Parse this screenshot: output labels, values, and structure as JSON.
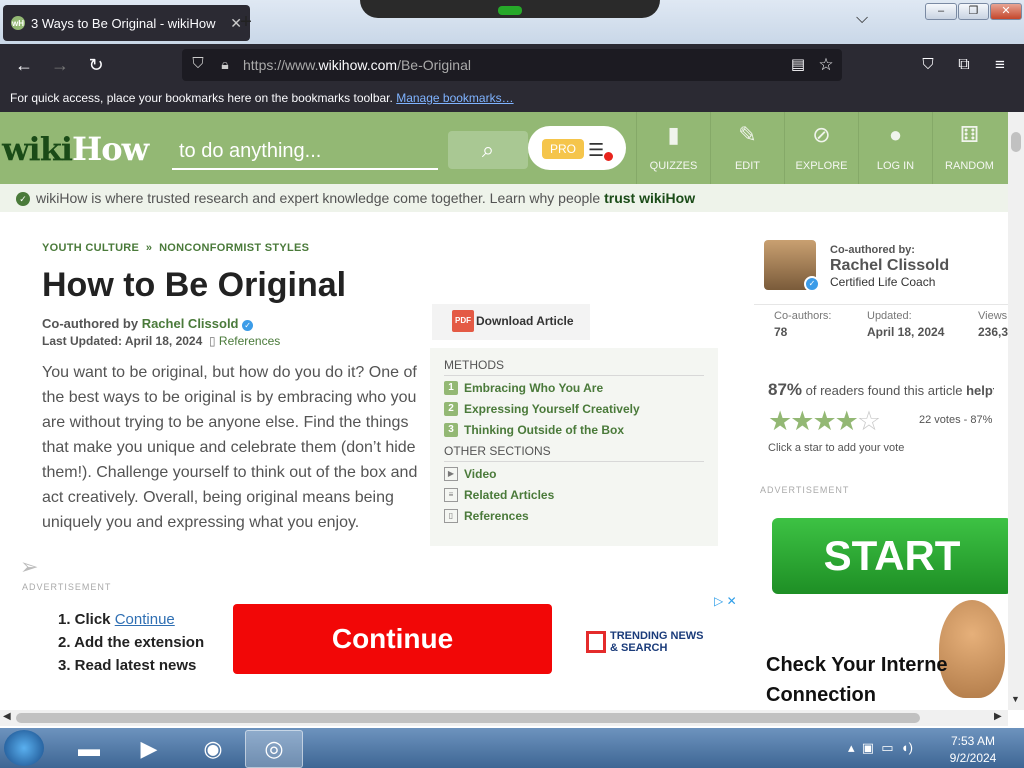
{
  "browser": {
    "tab_title": "3 Ways to Be Original - wikiHow",
    "tab_favicon": "wH",
    "url_prefix": "https://www.",
    "url_domain": "wikihow.com",
    "url_path": "/Be-Original",
    "bookmarks_text": "For quick access, place your bookmarks here on the bookmarks toolbar.",
    "bookmarks_link": "Manage bookmarks…"
  },
  "header": {
    "logo_wiki": "wiki",
    "logo_how": "How",
    "search_placeholder": "to do anything...",
    "pro_label": "PRO",
    "nav": [
      {
        "label": "QUIZZES",
        "icon": "quizzes-icon",
        "glyph": "▮"
      },
      {
        "label": "EDIT",
        "icon": "edit-icon",
        "glyph": "✎"
      },
      {
        "label": "EXPLORE",
        "icon": "explore-icon",
        "glyph": "⊘"
      },
      {
        "label": "LOG IN",
        "icon": "user-icon",
        "glyph": "●"
      },
      {
        "label": "RANDOM",
        "icon": "random-icon",
        "glyph": "⚅"
      }
    ]
  },
  "trust": {
    "text": "wikiHow is where trusted research and expert knowledge come together. Learn why people ",
    "bold": "trust wikiHow"
  },
  "article": {
    "breadcrumb_1": "YOUTH CULTURE",
    "breadcrumb_sep": "»",
    "breadcrumb_2": "NONCONFORMIST STYLES",
    "title": "How to Be Original",
    "coauthored_label": "Co-authored by",
    "coauthor": "Rachel Clissold",
    "updated": "Last Updated: April 18, 2024",
    "references": "References",
    "intro": "You want to be original, but how do you do it? One of the best ways to be original is by embracing who you are without trying to be anyone else. Find the things that make you unique and celebrate them (don’t hide them!). Challenge yourself to think out of the box and act creatively. Overall, being original means being uniquely you and expressing what you enjoy.",
    "download": "Download Article",
    "pdf": "PDF"
  },
  "toc": {
    "methods_heading": "METHODS",
    "methods": [
      {
        "num": "1",
        "label": "Embracing Who You Are"
      },
      {
        "num": "2",
        "label": "Expressing Yourself Creatively"
      },
      {
        "num": "3",
        "label": "Thinking Outside of the Box"
      }
    ],
    "other_heading": "OTHER SECTIONS",
    "other": [
      {
        "label": "Video"
      },
      {
        "label": "Related Articles"
      },
      {
        "label": "References"
      }
    ]
  },
  "ad": {
    "label": "ADVERTISEMENT",
    "step1_prefix": "1. Click ",
    "step1_link": "Continue",
    "step2": "2. Add the extension",
    "step3": "3. Read latest news",
    "button": "Continue",
    "brand_line1": "TRENDING NEWS",
    "brand_line2": "& SEARCH"
  },
  "sidebar": {
    "coauth_heading": "Co-authored by:",
    "name": "Rachel Clissold",
    "role": "Certified Life Coach",
    "coauthors_label": "Co-authors:",
    "coauthors_value": "78",
    "updated_label": "Updated:",
    "updated_value": "April 18, 2024",
    "views_label": "Views",
    "views_value": "236,3",
    "rating_pct": "87%",
    "rating_text": " of readers found this article ",
    "rating_bold": "helpfu",
    "votes": "22 votes - 87%",
    "rating_hint": "Click a star to add your vote",
    "ad_label": "ADVERTISEMENT",
    "ad_button": "START",
    "ad_text": "Check Your Interne Connection"
  },
  "taskbar": {
    "time": "7:53 AM",
    "date": "9/2/2024"
  },
  "colors": {
    "brand_green": "#93b874",
    "link_green": "#4a7a3a",
    "ad_red": "#f20707"
  }
}
